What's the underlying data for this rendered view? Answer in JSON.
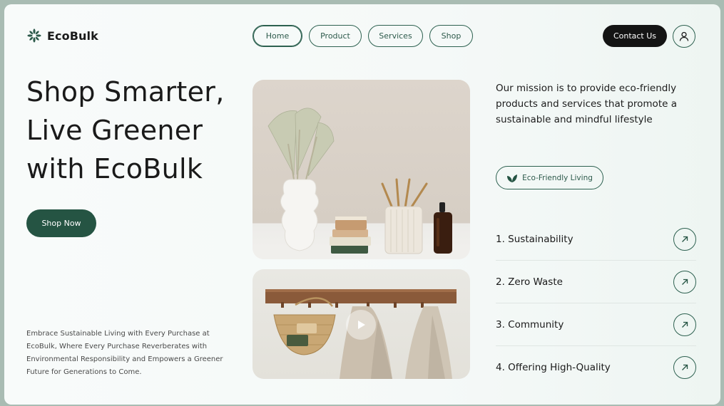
{
  "brand": {
    "name": "EcoBulk",
    "logo_icon": "leaf-burst-icon"
  },
  "nav": {
    "items": [
      {
        "label": "Home",
        "active": true
      },
      {
        "label": "Product",
        "active": false
      },
      {
        "label": "Services",
        "active": false
      },
      {
        "label": "Shop",
        "active": false
      }
    ]
  },
  "header": {
    "contact_label": "Contact Us",
    "user_icon": "user-icon"
  },
  "hero": {
    "title_lines": [
      "Shop Smarter,",
      "Live Greener",
      "with EcoBulk"
    ],
    "cta_label": "Shop Now",
    "description": "Embrace Sustainable Living with Every Purchase at EcoBulk, Where Every Purchase Reverberates with Environmental Responsibility and Empowers a Greener Future for Generations to Come."
  },
  "media": {
    "top_image": "bathroom-decor-photo",
    "bottom_video": "towel-hooks-video",
    "play_icon": "play-icon"
  },
  "mission": {
    "text": "Our mission is to provide eco-friendly products and services that promote a sustainable and mindful lifestyle"
  },
  "badge": {
    "label": "Eco-Friendly Living",
    "icon": "leaves-icon"
  },
  "features": [
    {
      "label": "1.  Sustainability"
    },
    {
      "label": "2.  Zero Waste"
    },
    {
      "label": "3.  Community"
    },
    {
      "label": "4.  Offering High-Quality"
    }
  ],
  "colors": {
    "accent": "#255443",
    "outline": "#2d6150",
    "dark": "#141414",
    "background": "#f5f9f8"
  }
}
